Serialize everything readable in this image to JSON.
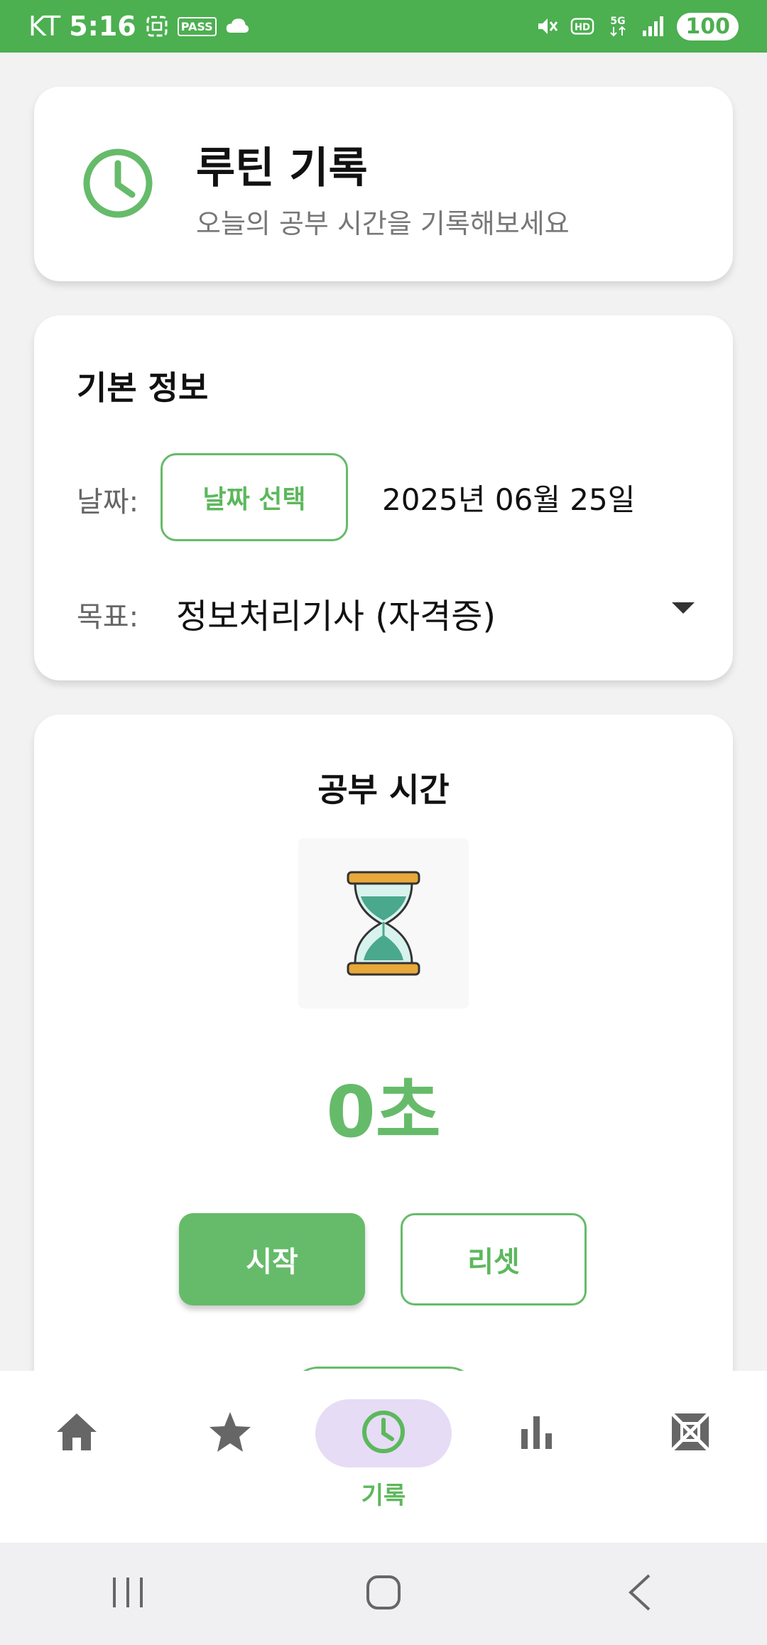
{
  "status_bar": {
    "carrier": "KT",
    "time": "5:16",
    "pass_badge": "PASS",
    "battery": "100",
    "icons": [
      "screenshot-icon",
      "pass-icon",
      "cloud-icon",
      "mute-icon",
      "hd-icon",
      "5g-icon",
      "signal-icon"
    ]
  },
  "header": {
    "title": "루틴 기록",
    "subtitle": "오늘의 공부 시간을 기록해보세요",
    "icon": "clock-icon"
  },
  "info": {
    "title": "기본 정보",
    "date_label": "날짜:",
    "date_button": "날짜 선택",
    "date_value": "2025년 06월 25일",
    "goal_label": "목표:",
    "goal_value": "정보처리기사 (자격증)"
  },
  "timer": {
    "title": "공부 시간",
    "value": "0초",
    "start_label": "시작",
    "reset_label": "리셋"
  },
  "bottom_nav": {
    "items": [
      {
        "icon": "home-icon",
        "label": ""
      },
      {
        "icon": "star-icon",
        "label": ""
      },
      {
        "icon": "clock-icon",
        "label": "기록",
        "active": true
      },
      {
        "icon": "bar-chart-icon",
        "label": ""
      },
      {
        "icon": "grid-icon",
        "label": ""
      }
    ]
  },
  "colors": {
    "accent": "#66bb6a",
    "status_bar": "#4caf50",
    "active_pill": "#e6dcf6"
  }
}
